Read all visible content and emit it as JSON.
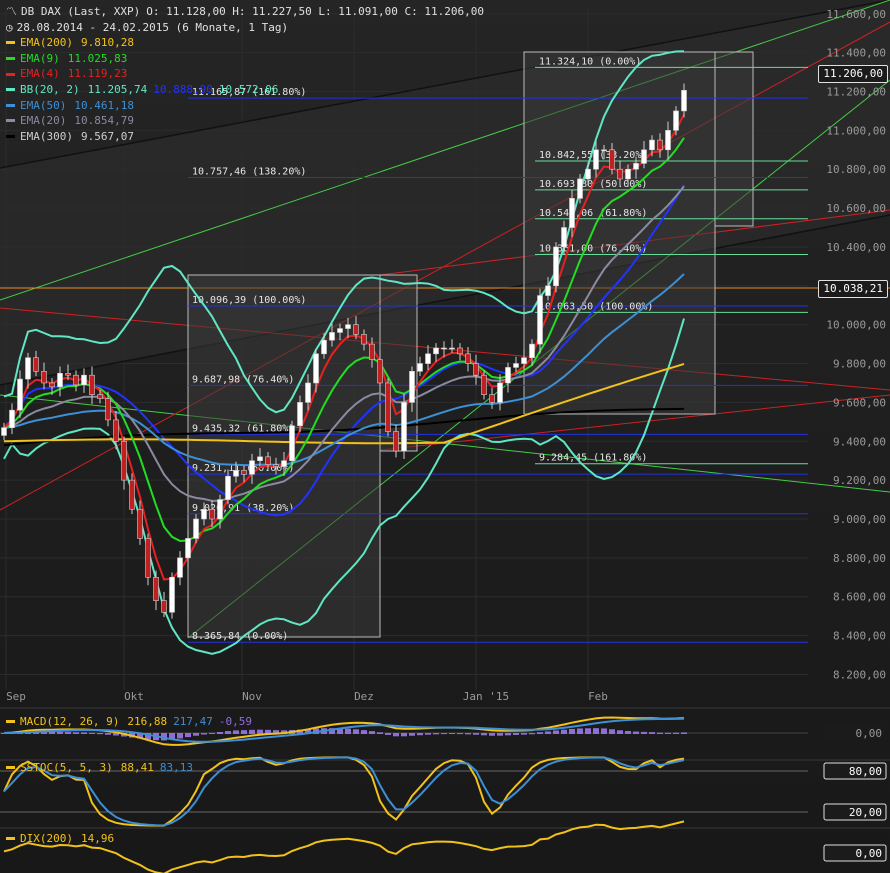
{
  "header": {
    "title": "DB DAX (Last, XXP)",
    "ohlc": "O: 11.128,00   H: 11.227,50   L: 11.091,00   C: 11.206,00",
    "range": "28.08.2014 - 24.02.2015 (6 Monate, 1 Tag)",
    "legend": [
      {
        "label": "EMA(200)",
        "values": "9.810,28",
        "color": "#f2c21b"
      },
      {
        "label": "EMA(9)",
        "values": "11.025,83",
        "color": "#22dd22"
      },
      {
        "label": "EMA(4)",
        "values": "11.119,23",
        "color": "#e82020"
      },
      {
        "label": "BB(20, 2)",
        "values": "11.205,74",
        "values2": "10.888,90",
        "values3": "10.572,06",
        "color": "#5fe7c4",
        "color2": "#2233ff",
        "color3": "#5fe7c4"
      },
      {
        "label": "EMA(50)",
        "values": "10.461,18",
        "color": "#3d8fd6"
      },
      {
        "label": "EMA(20)",
        "values": "10.854,79",
        "color": "#8a8aa0"
      },
      {
        "label": "EMA(300)",
        "values": "9.567,07",
        "color": "#000000"
      }
    ]
  },
  "chart_data": {
    "type": "line",
    "price_axis": {
      "ticks": [
        "11.600,00",
        "11.400,00",
        "11.200,00",
        "11.000,00",
        "10.800,00",
        "10.600,00",
        "10.400,00",
        "10.200,00",
        "10.000,00",
        "9.800,00",
        "9.600,00",
        "9.400,00",
        "9.200,00",
        "9.000,00",
        "8.800,00",
        "8.600,00",
        "8.400,00",
        "8.200,00"
      ],
      "ylim": [
        8120,
        11640
      ]
    },
    "month_labels": [
      "Sep",
      "Okt",
      "Nov",
      "Dez",
      "Jan '15",
      "Feb"
    ],
    "current_price": "11.206,00",
    "marker_price": "10.038,21",
    "fib_left": [
      {
        "label": "11.165,87 (161.80%)",
        "value": 11165.87
      },
      {
        "label": "10.757,46 (138.20%)",
        "value": 10757.46
      },
      {
        "label": "10.096,39 (100.00%)",
        "value": 10096.39
      },
      {
        "label": "9.687,98 (76.40%)",
        "value": 9687.98
      },
      {
        "label": "9.435,32 (61.80%)",
        "value": 9435.32
      },
      {
        "label": "9.231,11 (50.00%)",
        "value": 9231.11
      },
      {
        "label": "9.026,91 (38.20%)",
        "value": 9026.91
      },
      {
        "label": "8.365,84 (0.00%)",
        "value": 8365.84
      }
    ],
    "fib_right": [
      {
        "label": "11.324,10 (0.00%)",
        "value": 11324.1
      },
      {
        "label": "10.842,55 (38.20%)",
        "value": 10842.55
      },
      {
        "label": "10.693,80 (50.00%)",
        "value": 10693.8
      },
      {
        "label": "10.545,06 (61.80%)",
        "value": 10545.06
      },
      {
        "label": "10.361,00 (76.40%)",
        "value": 10361.0
      },
      {
        "label": "10.063,50 (100.00%)",
        "value": 10063.5
      },
      {
        "label": "9.284,45 (161.80%)",
        "value": 9284.45
      }
    ],
    "close_series": [
      9470,
      9560,
      9720,
      9830,
      9760,
      9700,
      9680,
      9750,
      9740,
      9690,
      9740,
      9640,
      9620,
      9510,
      9400,
      9200,
      9050,
      8900,
      8700,
      8580,
      8520,
      8700,
      8800,
      8900,
      9000,
      9050,
      9000,
      9100,
      9220,
      9250,
      9230,
      9300,
      9320,
      9280,
      9270,
      9300,
      9480,
      9600,
      9700,
      9850,
      9920,
      9960,
      9980,
      10000,
      9950,
      9900,
      9820,
      9700,
      9450,
      9350,
      9600,
      9760,
      9800,
      9850,
      9880,
      9880,
      9880,
      9850,
      9800,
      9740,
      9640,
      9600,
      9700,
      9780,
      9800,
      9830,
      9900,
      10150,
      10200,
      10400,
      10500,
      10650,
      10750,
      10800,
      10900,
      10900,
      10800,
      10750,
      10800,
      10830,
      10900,
      10950,
      10900,
      11000,
      11100,
      11206
    ],
    "subcharts": [
      {
        "label": "MACD(12, 26, 9)",
        "values": "216,88",
        "values2": "217,47",
        "values3": "-0,59",
        "ticks": [
          "0,00"
        ],
        "color": "#f2c21b",
        "color2": "#3d8fd6",
        "color3": "#8f6fd6"
      },
      {
        "label": "SSTOC(5, 5, 3)",
        "values": "88,41",
        "values2": "83,13",
        "ticks": [
          "80,00",
          "20,00"
        ],
        "color": "#f2c21b",
        "color2": "#3d8fd6"
      },
      {
        "label": "DIX(200)",
        "values": "14,96",
        "ticks": [
          "0,00"
        ],
        "color": "#f2c21b"
      }
    ]
  }
}
